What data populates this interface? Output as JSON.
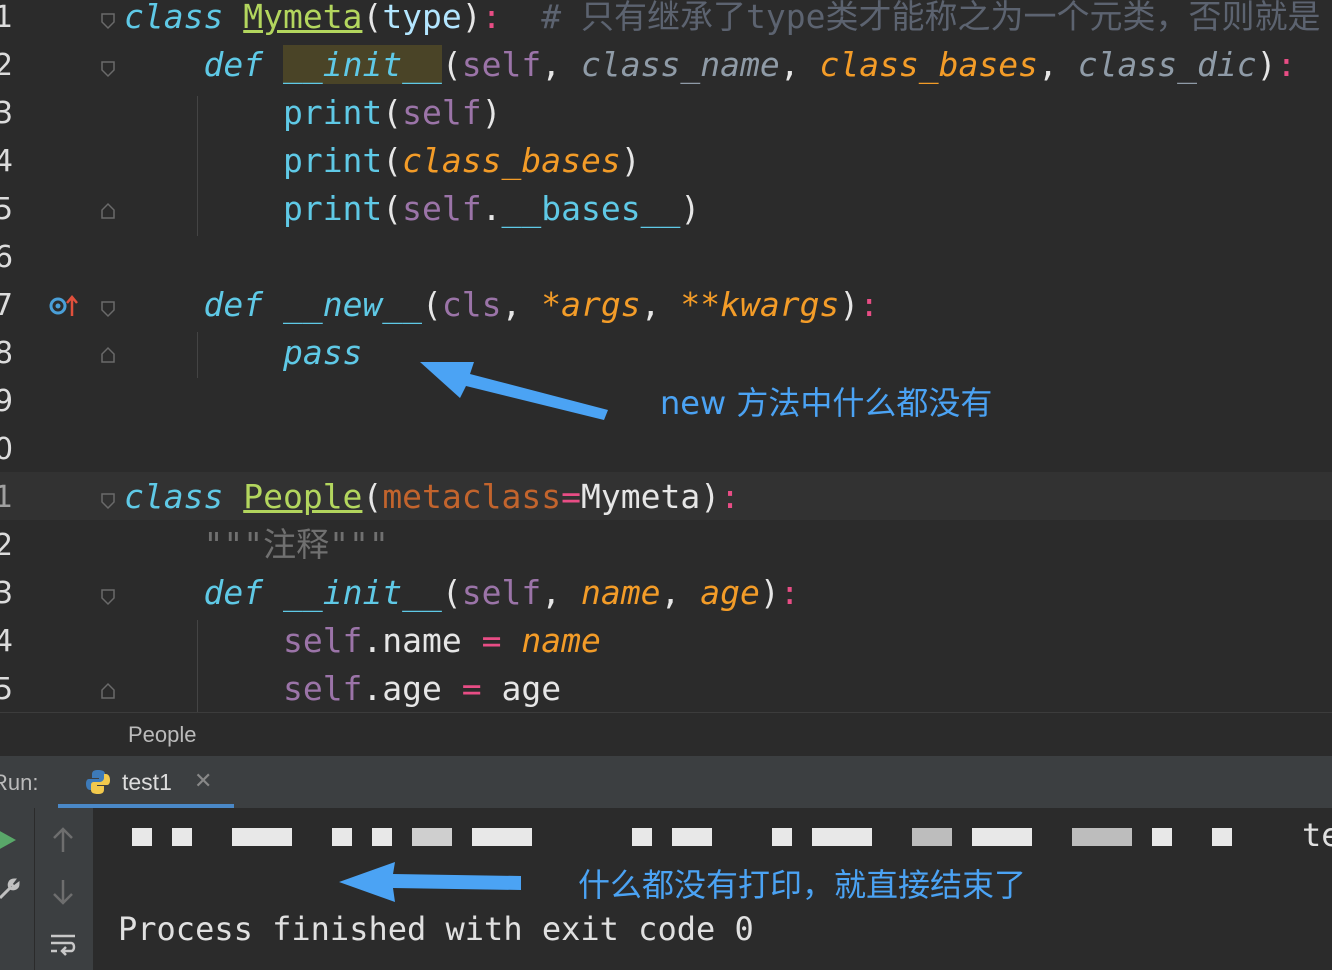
{
  "editor": {
    "line_numbers": [
      "1",
      "2",
      "3",
      "4",
      "5",
      "6",
      "7",
      "8",
      "9",
      "0",
      "1",
      "2",
      "3",
      "4",
      "5"
    ],
    "line1": {
      "kw": "class",
      "name": "Mymeta",
      "open": "(",
      "base": "type",
      "close": ")",
      "colon": ":",
      "comment": "# 只有继承了type类才能称之为一个元类，否则就是"
    },
    "line2": {
      "kw": "def",
      "fn": "__init__",
      "open": "(",
      "self": "self",
      "p1": "class_name",
      "p2": "class_bases",
      "p3": "class_dic",
      "close": ")",
      "colon": ":"
    },
    "line3": {
      "fn": "print",
      "open": "(",
      "arg": "self",
      "close": ")"
    },
    "line4": {
      "fn": "print",
      "open": "(",
      "arg": "class_bases",
      "close": ")"
    },
    "line5": {
      "fn": "print",
      "open": "(",
      "self": "self",
      "dot": ".",
      "attr": "__bases__",
      "close": ")"
    },
    "line7": {
      "kw": "def",
      "fn": "__new__",
      "open": "(",
      "p1": "cls",
      "p2": "*args",
      "p3": "**kwargs",
      "close": ")",
      "colon": ":"
    },
    "line8": {
      "kw": "pass"
    },
    "line11": {
      "kw": "class",
      "name": "People",
      "open": "(",
      "kwarg": "metaclass",
      "eq": "=",
      "val": "Mymeta",
      "close": ")",
      "colon": ":"
    },
    "line12": {
      "doc": "\"\"\"注释\"\"\""
    },
    "line13": {
      "kw": "def",
      "fn": "__init__",
      "open": "(",
      "self": "self",
      "p1": "name",
      "p2": "age",
      "close": ")",
      "colon": ":"
    },
    "line14": {
      "self": "self",
      "attr": ".name",
      "eq": "=",
      "val": "name"
    },
    "line15": {
      "self": "self",
      "attr": ".age",
      "eq": "=",
      "val": "age"
    }
  },
  "annotations": {
    "new_note": "new 方法中什么都没有",
    "print_note": "什么都没有打印，就直接结束了"
  },
  "breadcrumb": "People",
  "run_panel": {
    "label": "Run:",
    "tab_name": "test1",
    "partial_path_tail": "te",
    "exit_message": "Process finished with exit code 0"
  },
  "colors": {
    "keyword": "#5fc9e6",
    "class_name": "#b3d65e",
    "self": "#9b74a8",
    "param_orange": "#f39c28",
    "annotation_blue": "#4ba3f4",
    "background": "#2b2b2b"
  },
  "icons": [
    "fold-marker-icon",
    "override-gutter-icon",
    "python-icon",
    "close-icon",
    "run-icon",
    "up-arrow-icon",
    "down-arrow-icon",
    "wrench-icon",
    "soft-wrap-icon"
  ]
}
